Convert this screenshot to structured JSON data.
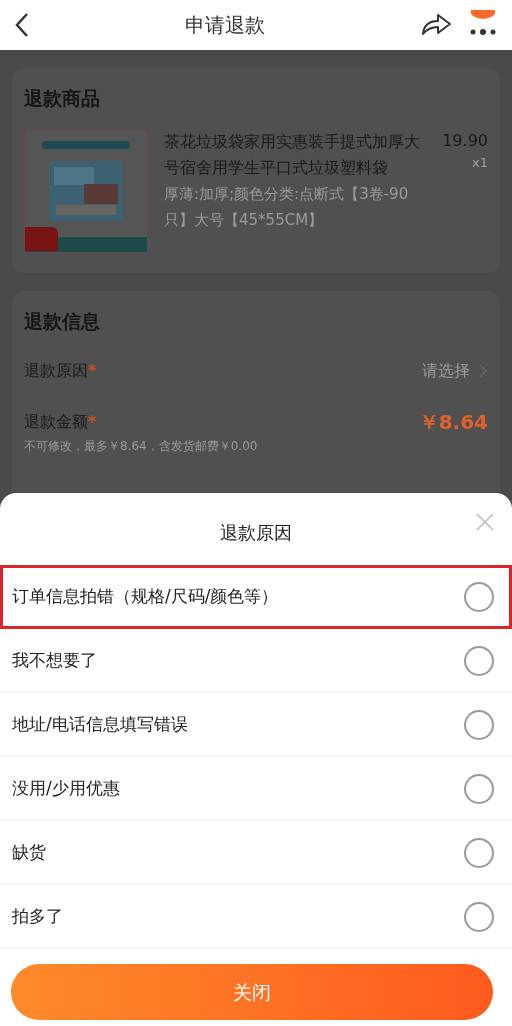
{
  "nav": {
    "title": "申请退款"
  },
  "product_card": {
    "title": "退款商品",
    "product": {
      "name": "茶花垃圾袋家用实惠装手提式加厚大号宿舍用学生平口式垃圾塑料袋",
      "price": "19.90",
      "quantity": "x1",
      "spec": "厚薄:加厚;颜色分类:点断式【3卷-90只】大号【45*55CM】"
    }
  },
  "info_card": {
    "title": "退款信息",
    "fields": [
      {
        "kind": "select",
        "label": "退款原因",
        "mark": "*",
        "value": "请选择"
      },
      {
        "kind": "amount",
        "label": "退款金额",
        "mark": "*",
        "value": "￥8.64",
        "note": "不可修改，最多￥8.64，含发货邮费￥0.00"
      }
    ]
  },
  "sheet": {
    "title": "退款原因",
    "options": [
      {
        "label": "订单信息拍错（规格/尺码/颜色等）",
        "selected": false,
        "highlighted": true
      },
      {
        "label": "我不想要了",
        "selected": false,
        "highlighted": false
      },
      {
        "label": "地址/电话信息填写错误",
        "selected": false,
        "highlighted": false
      },
      {
        "label": "没用/少用优惠",
        "selected": false,
        "highlighted": false
      },
      {
        "label": "缺货",
        "selected": false,
        "highlighted": false
      },
      {
        "label": "拍多了",
        "selected": false,
        "highlighted": false
      }
    ],
    "close_button": "关闭"
  }
}
